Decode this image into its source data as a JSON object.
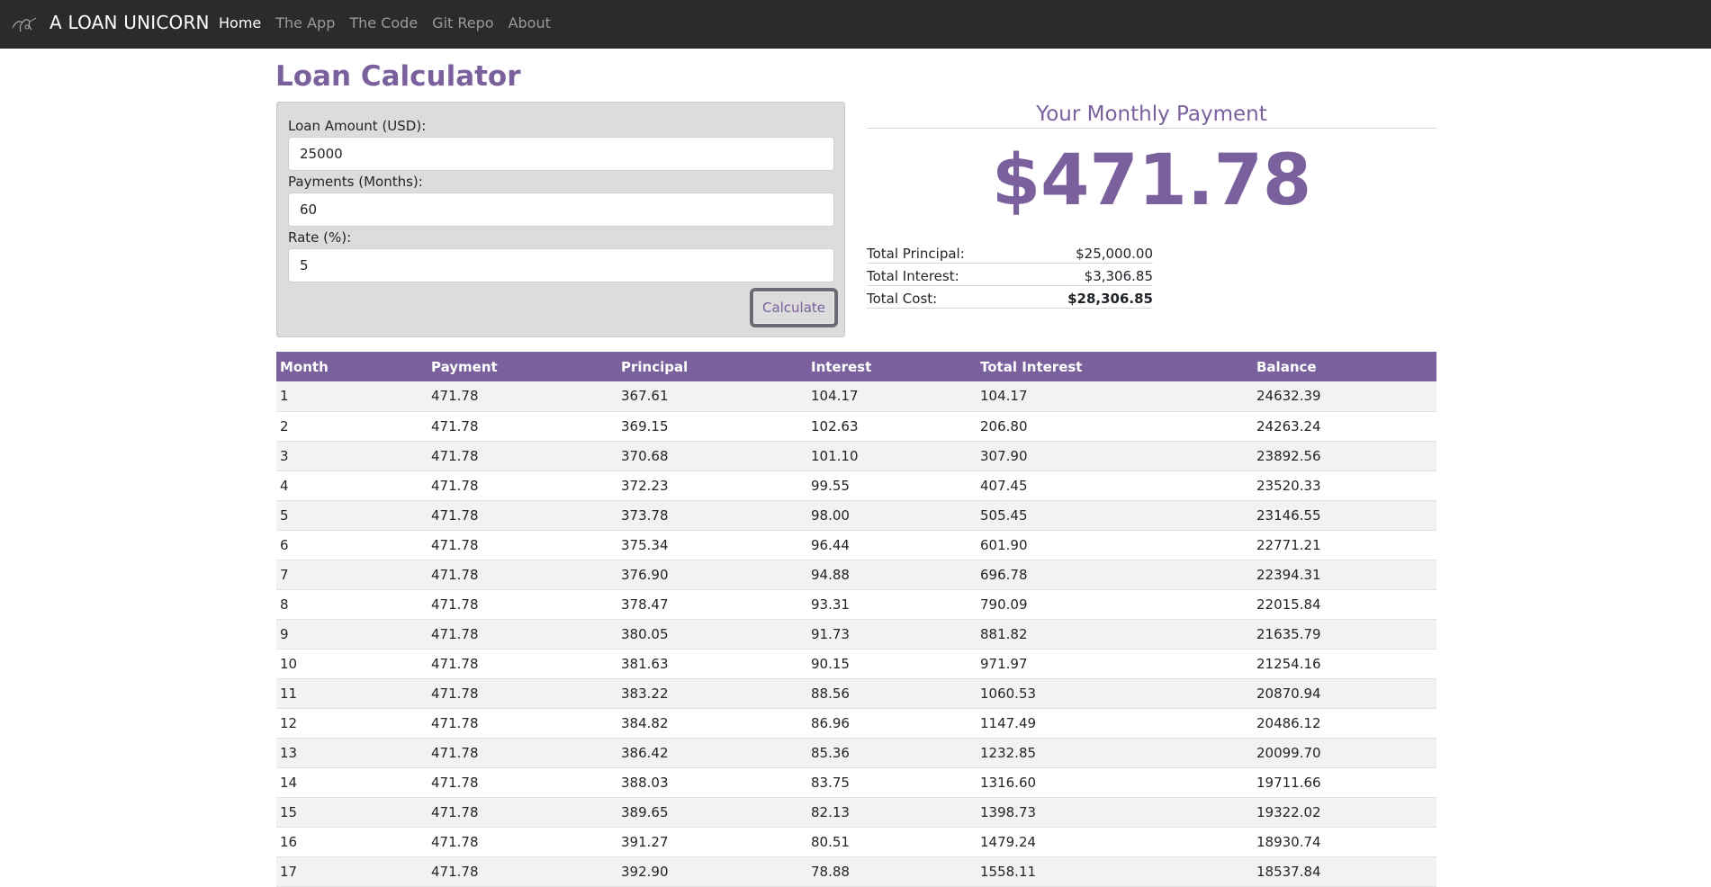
{
  "nav": {
    "brand": "A LOAN UNICORN",
    "links": [
      "Home",
      "The App",
      "The Code",
      "Git Repo",
      "About"
    ],
    "active": "Home"
  },
  "page": {
    "title": "Loan Calculator"
  },
  "form": {
    "amount_label": "Loan Amount (USD):",
    "amount_value": "25000",
    "payments_label": "Payments (Months):",
    "payments_value": "60",
    "rate_label": "Rate (%):",
    "rate_value": "5",
    "calculate_label": "Calculate"
  },
  "results": {
    "heading": "Your Monthly Payment",
    "monthly_payment": "$471.78",
    "principal_label": "Total Principal:",
    "principal_value": "$25,000.00",
    "interest_label": "Total Interest:",
    "interest_value": "$3,306.85",
    "cost_label": "Total Cost:",
    "cost_value": "$28,306.85"
  },
  "table": {
    "headers": [
      "Month",
      "Payment",
      "Principal",
      "Interest",
      "Total Interest",
      "Balance"
    ],
    "rows": [
      [
        "1",
        "471.78",
        "367.61",
        "104.17",
        "104.17",
        "24632.39"
      ],
      [
        "2",
        "471.78",
        "369.15",
        "102.63",
        "206.80",
        "24263.24"
      ],
      [
        "3",
        "471.78",
        "370.68",
        "101.10",
        "307.90",
        "23892.56"
      ],
      [
        "4",
        "471.78",
        "372.23",
        "99.55",
        "407.45",
        "23520.33"
      ],
      [
        "5",
        "471.78",
        "373.78",
        "98.00",
        "505.45",
        "23146.55"
      ],
      [
        "6",
        "471.78",
        "375.34",
        "96.44",
        "601.90",
        "22771.21"
      ],
      [
        "7",
        "471.78",
        "376.90",
        "94.88",
        "696.78",
        "22394.31"
      ],
      [
        "8",
        "471.78",
        "378.47",
        "93.31",
        "790.09",
        "22015.84"
      ],
      [
        "9",
        "471.78",
        "380.05",
        "91.73",
        "881.82",
        "21635.79"
      ],
      [
        "10",
        "471.78",
        "381.63",
        "90.15",
        "971.97",
        "21254.16"
      ],
      [
        "11",
        "471.78",
        "383.22",
        "88.56",
        "1060.53",
        "20870.94"
      ],
      [
        "12",
        "471.78",
        "384.82",
        "86.96",
        "1147.49",
        "20486.12"
      ],
      [
        "13",
        "471.78",
        "386.42",
        "85.36",
        "1232.85",
        "20099.70"
      ],
      [
        "14",
        "471.78",
        "388.03",
        "83.75",
        "1316.60",
        "19711.66"
      ],
      [
        "15",
        "471.78",
        "389.65",
        "82.13",
        "1398.73",
        "19322.02"
      ],
      [
        "16",
        "471.78",
        "391.27",
        "80.51",
        "1479.24",
        "18930.74"
      ],
      [
        "17",
        "471.78",
        "392.90",
        "78.88",
        "1558.11",
        "18537.84"
      ]
    ]
  },
  "colors": {
    "accent": "#7a619d",
    "navbar": "#2b2b2b",
    "panel": "#dcdcdc"
  }
}
